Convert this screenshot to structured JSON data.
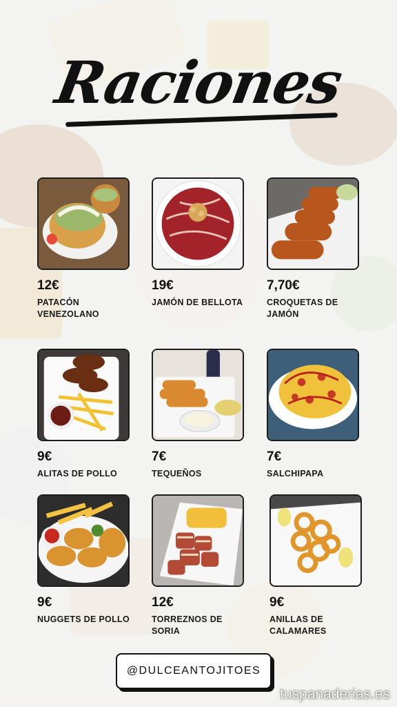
{
  "title": "Raciones",
  "items": [
    {
      "price": "12€",
      "name": "PATACÓN\nVENEZOLANO",
      "image": "patacon-plate"
    },
    {
      "price": "19€",
      "name": "JAMÓN DE BELLOTA",
      "image": "ham-plate"
    },
    {
      "price": "7,70€",
      "name": "CROQUETAS DE\nJAMÓN",
      "image": "croquettes-plate"
    },
    {
      "price": "9€",
      "name": "ALITAS DE POLLO",
      "image": "wings-plate"
    },
    {
      "price": "7€",
      "name": "TEQUEÑOS",
      "image": "tequenos-plate"
    },
    {
      "price": "7€",
      "name": "SALCHIPAPA",
      "image": "salchipapa-plate"
    },
    {
      "price": "9€",
      "name": "NUGGETS DE POLLO",
      "image": "nuggets-plate"
    },
    {
      "price": "12€",
      "name": "TORREZNOS DE\nSORIA",
      "image": "torreznos-plate"
    },
    {
      "price": "9€",
      "name": "ANILLAS DE\nCALAMARES",
      "image": "calamares-plate"
    }
  ],
  "handle": "@DULCEANTOJITOES",
  "watermark": "tuspanaderias.es"
}
